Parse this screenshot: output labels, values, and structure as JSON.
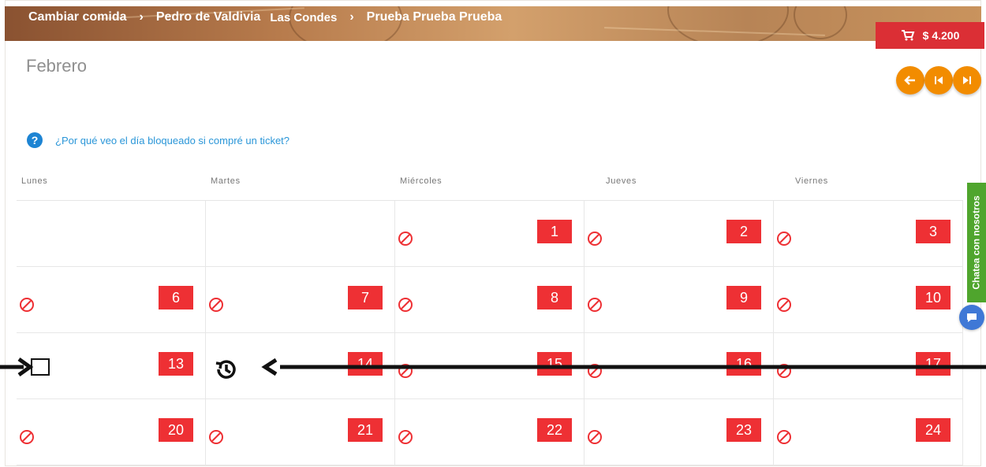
{
  "header": {
    "breadcrumbs": [
      {
        "label": "Cambiar comida"
      },
      {
        "label": "Pedro de Valdivia",
        "subtag": "Las Condes"
      },
      {
        "label": "Prueba Prueba Prueba"
      }
    ],
    "cart_total": "$ 4.200"
  },
  "calendar": {
    "month": "Febrero",
    "help_text": "¿Por qué veo el día bloqueado si compré un ticket?",
    "weekdays": [
      "Lunes",
      "Martes",
      "Miércoles",
      "Jueves",
      "Viernes"
    ],
    "rows": [
      [
        "",
        "",
        "1",
        "2",
        "3"
      ],
      [
        "6",
        "7",
        "8",
        "9",
        "10"
      ],
      [
        "13",
        "14",
        "15",
        "16",
        "17"
      ],
      [
        "20",
        "21",
        "22",
        "23",
        "24"
      ]
    ]
  },
  "chat": {
    "label": "Chatea con nosotros"
  },
  "colors": {
    "accent": "#f28c00",
    "date_tag": "#ee3034",
    "cart": "#db2f35",
    "chat": "#4fa52d",
    "help_link": "#2a96d8"
  },
  "icons": {
    "cart": "shopping-cart-icon",
    "previous": "arrow-left-icon",
    "first": "skip-first-icon",
    "last": "skip-last-icon",
    "help": "question-circle-icon",
    "blocked": "blocked-icon",
    "history": "history-icon",
    "chat": "chat-bubble-icon"
  }
}
